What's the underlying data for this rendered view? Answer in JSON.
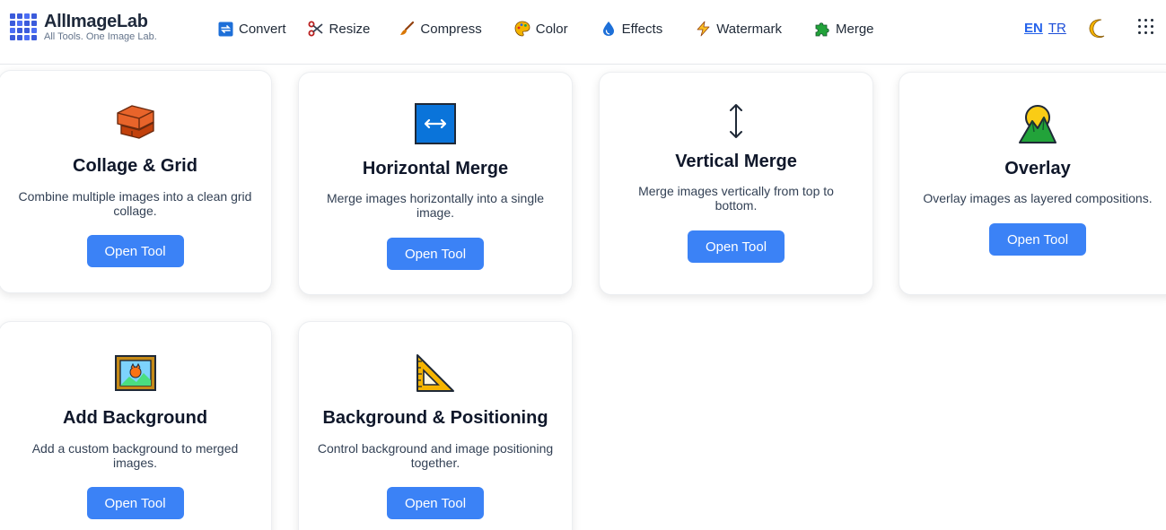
{
  "header": {
    "logo": {
      "name": "AllImageLab",
      "tagline": "All Tools. One Image Lab."
    },
    "nav": [
      {
        "label": "Convert",
        "icon": "convert-icon"
      },
      {
        "label": "Resize",
        "icon": "scissors-icon"
      },
      {
        "label": "Compress",
        "icon": "brush-icon"
      },
      {
        "label": "Color",
        "icon": "palette-icon"
      },
      {
        "label": "Effects",
        "icon": "droplet-icon"
      },
      {
        "label": "Watermark",
        "icon": "lightning-icon"
      },
      {
        "label": "Merge",
        "icon": "puzzle-icon"
      }
    ],
    "languages": [
      {
        "code": "EN",
        "active": true
      },
      {
        "code": "TR",
        "active": false
      }
    ],
    "theme_icon": "moon-icon",
    "apps_icon": "apps-grid-icon"
  },
  "cards": [
    {
      "title": "Collage & Grid",
      "description": "Combine multiple images into a clean grid collage.",
      "button": "Open Tool",
      "icon": "bricks-icon"
    },
    {
      "title": "Horizontal Merge",
      "description": "Merge images horizontally into a single image.",
      "button": "Open Tool",
      "icon": "left-right-arrow-icon"
    },
    {
      "title": "Vertical Merge",
      "description": "Merge images vertically from top to bottom.",
      "button": "Open Tool",
      "icon": "up-down-arrow-icon"
    },
    {
      "title": "Overlay",
      "description": "Overlay images as layered compositions.",
      "button": "Open Tool",
      "icon": "sunrise-mountain-icon"
    },
    {
      "title": "Add Background",
      "description": "Add a custom background to merged images.",
      "button": "Open Tool",
      "icon": "framed-picture-icon"
    },
    {
      "title": "Background & Positioning",
      "description": "Control background and image positioning together.",
      "button": "Open Tool",
      "icon": "triangular-ruler-icon"
    }
  ],
  "colors": {
    "accent": "#3b82f6",
    "brand": "#3b5bdb",
    "link": "#1d4ed8"
  }
}
